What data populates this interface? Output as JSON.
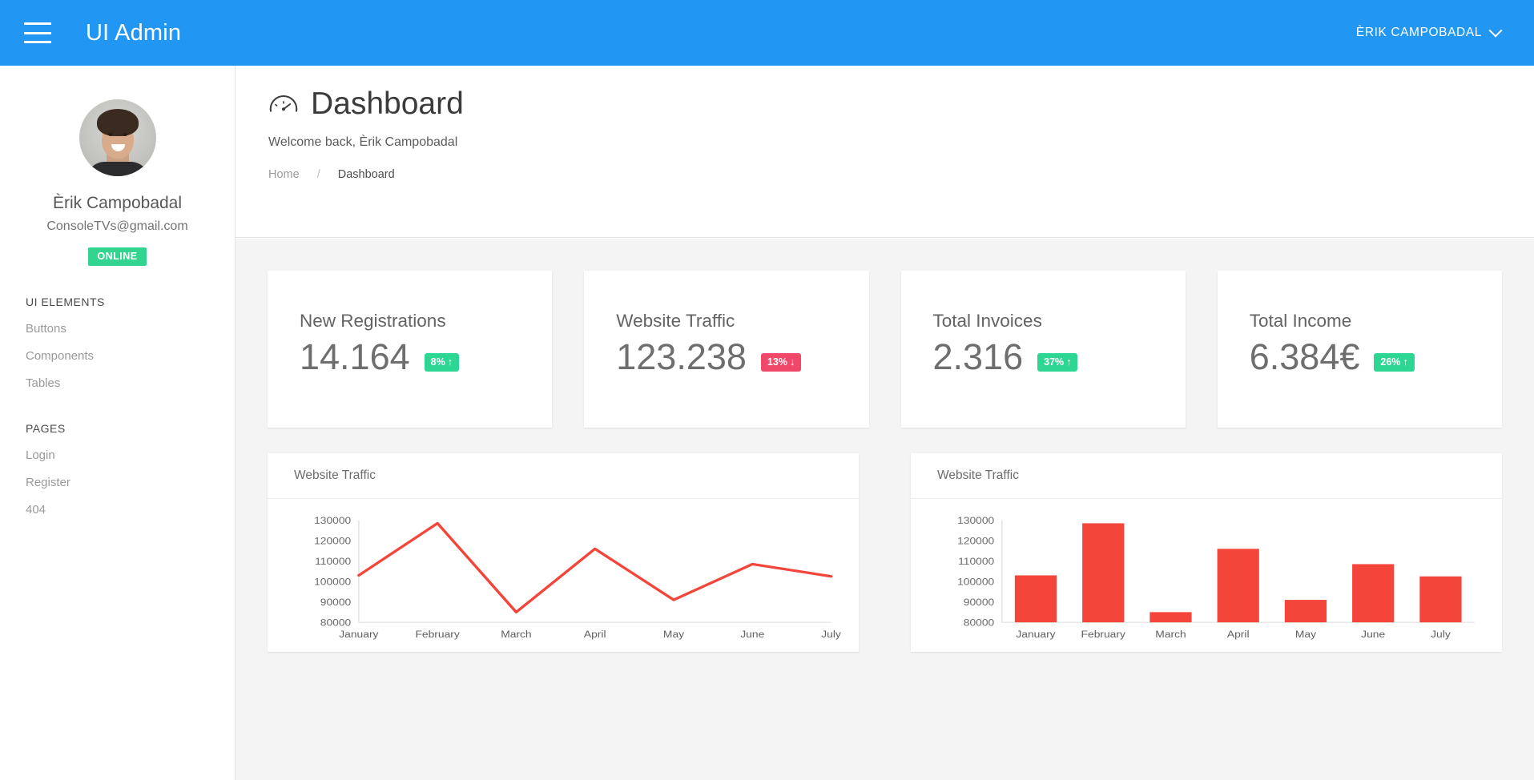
{
  "topbar": {
    "menu_icon": "hamburger-icon",
    "brand": "UI Admin",
    "user_menu": "ÈRIK CAMPOBADAL",
    "caret_icon": "chevron-down-icon"
  },
  "sidebar": {
    "avatar_alt": "avatar",
    "user_name": "Èrik Campobadal",
    "user_email": "ConsoleTVs@gmail.com",
    "status": "ONLINE",
    "groups": [
      {
        "title": "UI ELEMENTS",
        "items": [
          {
            "label": "Buttons"
          },
          {
            "label": "Components"
          },
          {
            "label": "Tables"
          }
        ]
      },
      {
        "title": "PAGES",
        "items": [
          {
            "label": "Login"
          },
          {
            "label": "Register"
          },
          {
            "label": "404"
          }
        ]
      }
    ]
  },
  "header": {
    "icon": "gauge-icon",
    "title": "Dashboard",
    "welcome": "Welcome back, Èrik Campobadal",
    "breadcrumb": {
      "home": "Home",
      "separator": "/",
      "current": "Dashboard"
    }
  },
  "stats": [
    {
      "label": "New Registrations",
      "value": "14.164",
      "change": "8%",
      "direction": "up",
      "arrow": "↑",
      "color": "#2ed694"
    },
    {
      "label": "Website Traffic",
      "value": "123.238",
      "change": "13%",
      "direction": "down",
      "arrow": "↓",
      "color": "#ef4868"
    },
    {
      "label": "Total Invoices",
      "value": "2.316",
      "change": "37%",
      "direction": "up",
      "arrow": "↑",
      "color": "#2ed694"
    },
    {
      "label": "Total Income",
      "value": "6.384€",
      "change": "26%",
      "direction": "up",
      "arrow": "↑",
      "color": "#2ed694"
    }
  ],
  "charts": [
    {
      "title": "Website Traffic"
    },
    {
      "title": "Website Traffic"
    }
  ],
  "chart_data": [
    {
      "type": "line",
      "title": "Website Traffic",
      "categories": [
        "January",
        "February",
        "March",
        "April",
        "May",
        "June",
        "July"
      ],
      "values": [
        103000,
        128500,
        85000,
        116000,
        91000,
        108500,
        102500
      ],
      "xlabel": "",
      "ylabel": "",
      "ylim": [
        80000,
        130000
      ],
      "yticks": [
        80000,
        90000,
        100000,
        110000,
        120000,
        130000
      ],
      "ytick_labels": [
        "80000",
        "90000",
        "100000",
        "110000",
        "120000",
        "130000"
      ],
      "series_color": "#f4453a",
      "grid": false,
      "legend": "none"
    },
    {
      "type": "bar",
      "title": "Website Traffic",
      "categories": [
        "January",
        "February",
        "March",
        "April",
        "May",
        "June",
        "July"
      ],
      "values": [
        103000,
        128500,
        85000,
        116000,
        91000,
        108500,
        102500
      ],
      "xlabel": "",
      "ylabel": "",
      "ylim": [
        80000,
        130000
      ],
      "yticks": [
        80000,
        90000,
        100000,
        110000,
        120000,
        130000
      ],
      "ytick_labels": [
        "80000",
        "90000",
        "100000",
        "110000",
        "120000",
        "130000"
      ],
      "series_color": "#f4453a",
      "grid": false,
      "legend": "none"
    }
  ],
  "theme": {
    "brand_blue": "#2196f3",
    "green": "#2ed694",
    "red": "#ef4868",
    "chart_red": "#f4453a",
    "page_bg": "#f4f4f4"
  }
}
